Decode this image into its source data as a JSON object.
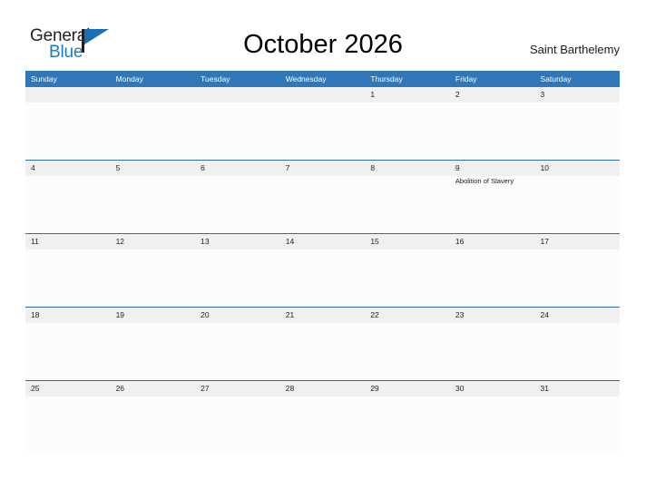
{
  "brand": {
    "name_part1": "General",
    "name_part2": "Blue",
    "flag_color": "#1a6fb5"
  },
  "header": {
    "title": "October 2026",
    "location": "Saint Barthelemy"
  },
  "theme": {
    "header_blue": "#3077b8",
    "row_line_blue": "#2f6da8",
    "band_gray": "#f0f0f0",
    "cell_white": "#fcfcfc"
  },
  "calendar": {
    "weekdays": [
      "Sunday",
      "Monday",
      "Tuesday",
      "Wednesday",
      "Thursday",
      "Friday",
      "Saturday"
    ],
    "weeks": [
      [
        {
          "day": "",
          "event": ""
        },
        {
          "day": "",
          "event": ""
        },
        {
          "day": "",
          "event": ""
        },
        {
          "day": "",
          "event": ""
        },
        {
          "day": "1",
          "event": ""
        },
        {
          "day": "2",
          "event": ""
        },
        {
          "day": "3",
          "event": ""
        }
      ],
      [
        {
          "day": "4",
          "event": ""
        },
        {
          "day": "5",
          "event": ""
        },
        {
          "day": "6",
          "event": ""
        },
        {
          "day": "7",
          "event": ""
        },
        {
          "day": "8",
          "event": ""
        },
        {
          "day": "9",
          "event": "Abolition of Slavery"
        },
        {
          "day": "10",
          "event": ""
        }
      ],
      [
        {
          "day": "11",
          "event": ""
        },
        {
          "day": "12",
          "event": ""
        },
        {
          "day": "13",
          "event": ""
        },
        {
          "day": "14",
          "event": ""
        },
        {
          "day": "15",
          "event": ""
        },
        {
          "day": "16",
          "event": ""
        },
        {
          "day": "17",
          "event": ""
        }
      ],
      [
        {
          "day": "18",
          "event": ""
        },
        {
          "day": "19",
          "event": ""
        },
        {
          "day": "20",
          "event": ""
        },
        {
          "day": "21",
          "event": ""
        },
        {
          "day": "22",
          "event": ""
        },
        {
          "day": "23",
          "event": ""
        },
        {
          "day": "24",
          "event": ""
        }
      ],
      [
        {
          "day": "25",
          "event": ""
        },
        {
          "day": "26",
          "event": ""
        },
        {
          "day": "27",
          "event": ""
        },
        {
          "day": "28",
          "event": ""
        },
        {
          "day": "29",
          "event": ""
        },
        {
          "day": "30",
          "event": ""
        },
        {
          "day": "31",
          "event": ""
        }
      ]
    ]
  }
}
